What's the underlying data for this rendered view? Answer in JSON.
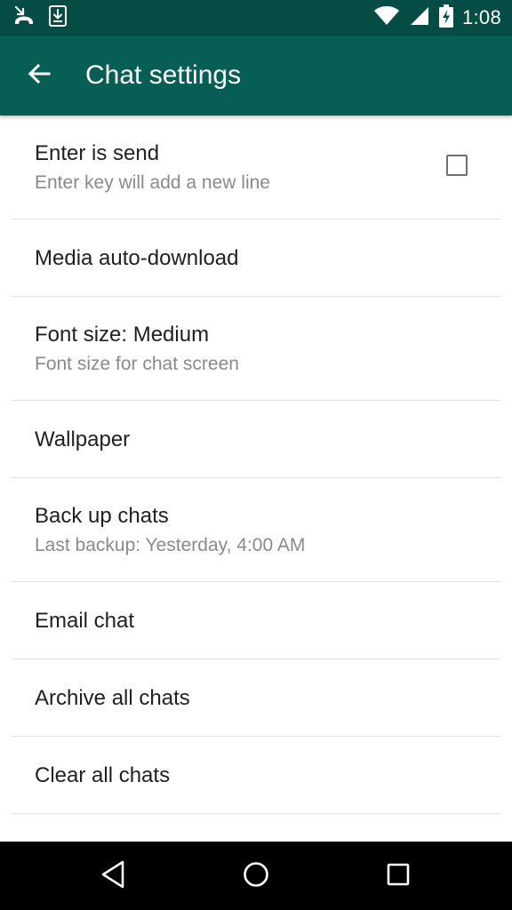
{
  "status_bar": {
    "time": "1:08",
    "icons": [
      "missed-call-icon",
      "download-icon",
      "wifi-icon",
      "signal-icon",
      "battery-charging-icon"
    ]
  },
  "app_bar": {
    "title": "Chat settings",
    "back_icon": "arrow-left-icon"
  },
  "settings": [
    {
      "title": "Enter is send",
      "summary": "Enter key will add a new line",
      "checked": false
    },
    {
      "title": "Media auto-download"
    },
    {
      "title": "Font size: Medium",
      "summary": "Font size for chat screen"
    },
    {
      "title": "Wallpaper"
    },
    {
      "title": "Back up chats",
      "summary": "Last backup: Yesterday, 4:00 AM"
    },
    {
      "title": "Email chat"
    },
    {
      "title": "Archive all chats"
    },
    {
      "title": "Clear all chats"
    }
  ],
  "nav_bar": {
    "icons": [
      "nav-back-icon",
      "nav-home-icon",
      "nav-recents-icon"
    ]
  },
  "colors": {
    "status_bar": "#054d44",
    "app_bar": "#075e54",
    "title_text": "#212121",
    "summary_text": "#8a8a8a",
    "divider": "#e2e2e2"
  }
}
